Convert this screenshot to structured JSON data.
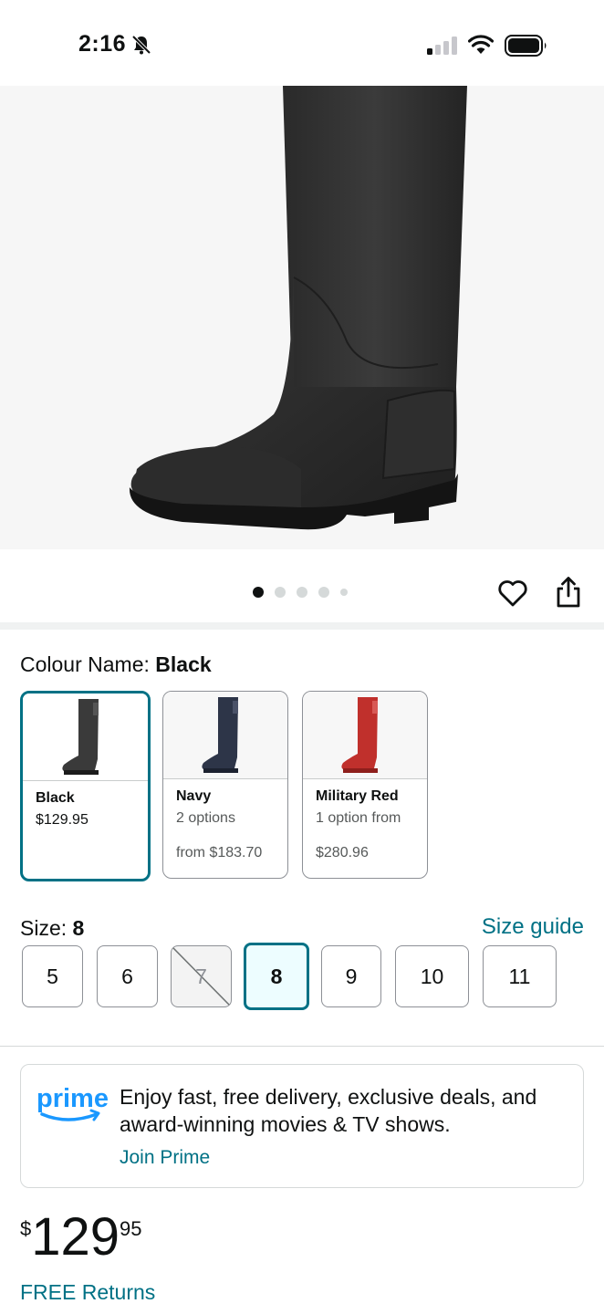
{
  "status_bar": {
    "time": "2:16",
    "icons": [
      "bell-slash-icon",
      "cellular-signal-icon",
      "wifi-icon",
      "battery-icon"
    ]
  },
  "gallery": {
    "image": "black-rain-boot-photo",
    "dots_total": 5,
    "dots_active": 1,
    "actions": [
      "heart-icon",
      "share-icon"
    ]
  },
  "colour": {
    "label": "Colour Name:",
    "selected": "Black",
    "options": [
      {
        "name": "Black",
        "line2": "$129.95",
        "line3": "",
        "boot_color": "#3a3a3a"
      },
      {
        "name": "Navy",
        "line2": "2 options",
        "line3": "from $183.70",
        "boot_color": "#2d3548"
      },
      {
        "name": "Military Red",
        "line2": "1 option from",
        "line3": "$280.96",
        "boot_color": "#c0302c"
      }
    ]
  },
  "size": {
    "label": "Size:",
    "selected": "8",
    "guide_label": "Size guide",
    "options": [
      "5",
      "6",
      "7",
      "8",
      "9",
      "10",
      "11"
    ],
    "unavailable": [
      "7"
    ]
  },
  "prime": {
    "logo_text": "prime",
    "message": "Enjoy fast, free delivery, exclusive deals, and award-winning movies & TV shows.",
    "join_label": "Join Prime"
  },
  "price": {
    "currency": "$",
    "whole": "129",
    "fraction": "95"
  },
  "returns_label": "FREE Returns",
  "colors": {
    "accent": "#007185",
    "prime_blue": "#1a98ff",
    "text": "#0f1111"
  }
}
